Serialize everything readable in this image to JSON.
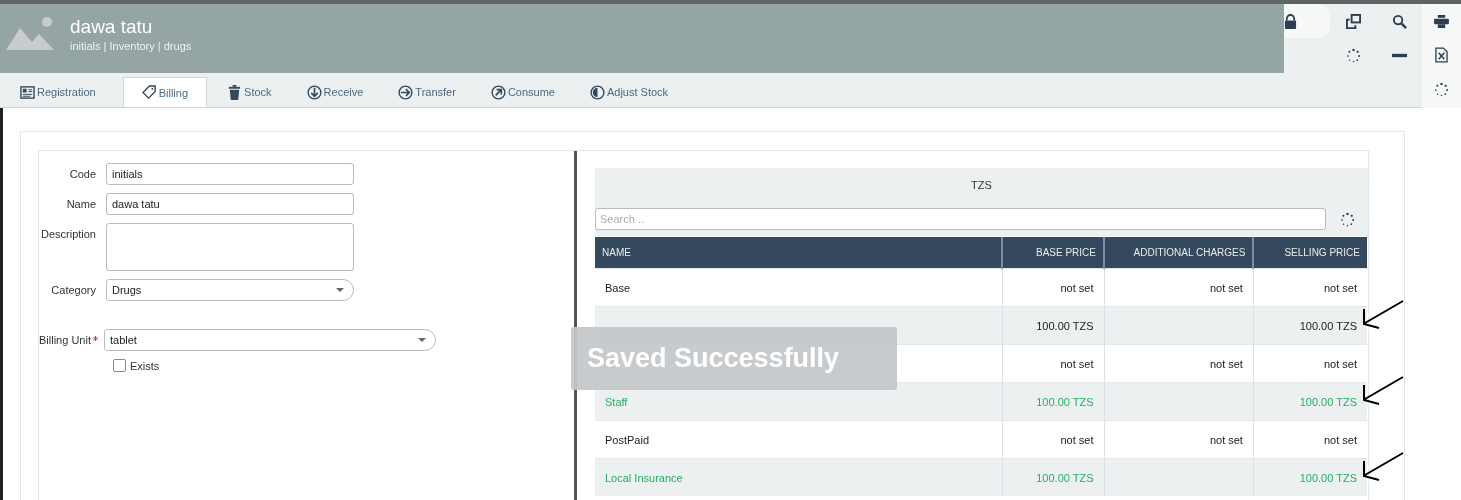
{
  "header": {
    "title": "dawa tatu",
    "breadcrumb": "initials | Inventory | drugs"
  },
  "toolbar": [
    {
      "kind": "lock",
      "selected": true
    },
    {
      "kind": "restore",
      "selected": false
    },
    {
      "kind": "search",
      "selected": false
    },
    {
      "kind": "spinner",
      "selected": false
    },
    {
      "kind": "minus",
      "selected": false
    }
  ],
  "side_toolbar": [
    {
      "kind": "print"
    },
    {
      "kind": "excel"
    },
    {
      "kind": "spinner"
    }
  ],
  "tabs": [
    {
      "label": "Registration",
      "selected": false
    },
    {
      "label": "Billing",
      "selected": true
    },
    {
      "label": "Stock",
      "selected": false
    },
    {
      "label": "Receive",
      "selected": false
    },
    {
      "label": "Transfer",
      "selected": false
    },
    {
      "label": "Consume",
      "selected": false
    },
    {
      "label": "Adjust Stock",
      "selected": false
    }
  ],
  "form": {
    "fields": [
      {
        "label": "Code",
        "kind": "text",
        "value": "initials"
      },
      {
        "label": "Name",
        "kind": "text",
        "value": "dawa tatu"
      },
      {
        "label": "Description",
        "kind": "textarea"
      },
      {
        "label": "Category",
        "kind": "select",
        "value": "Drugs"
      }
    ],
    "billing_unit": {
      "label": "Billing Unit",
      "required": true,
      "value": "tablet"
    },
    "exists": {
      "label": "Exists",
      "checked": false
    }
  },
  "prices": {
    "currency": "TZS",
    "search": {
      "placeholder": "Search .."
    },
    "columns": [
      "NAME",
      "BASE PRICE",
      "ADDITIONAL CHARGES",
      "SELLING PRICE"
    ],
    "rows": [
      {
        "cells": [
          "Base",
          "not set",
          "not set",
          "not set"
        ],
        "priced": false,
        "marked": false
      },
      {
        "cells": [
          "",
          "100.00 TZS",
          "",
          "100.00 TZS"
        ],
        "priced": false,
        "marked": true
      },
      {
        "cells": [
          "",
          "not set",
          "not set",
          "not set"
        ],
        "priced": false,
        "marked": false
      },
      {
        "cells": [
          "Staff",
          "100.00 TZS",
          "",
          "100.00 TZS"
        ],
        "priced": true,
        "marked": true
      },
      {
        "cells": [
          "PostPaid",
          "not set",
          "not set",
          "not set"
        ],
        "priced": false,
        "marked": false
      },
      {
        "cells": [
          "Local Insurance",
          "100.00 TZS",
          "",
          "100.00 TZS"
        ],
        "priced": true,
        "marked": true
      }
    ]
  },
  "toast": {
    "message": "Saved Successfully"
  }
}
